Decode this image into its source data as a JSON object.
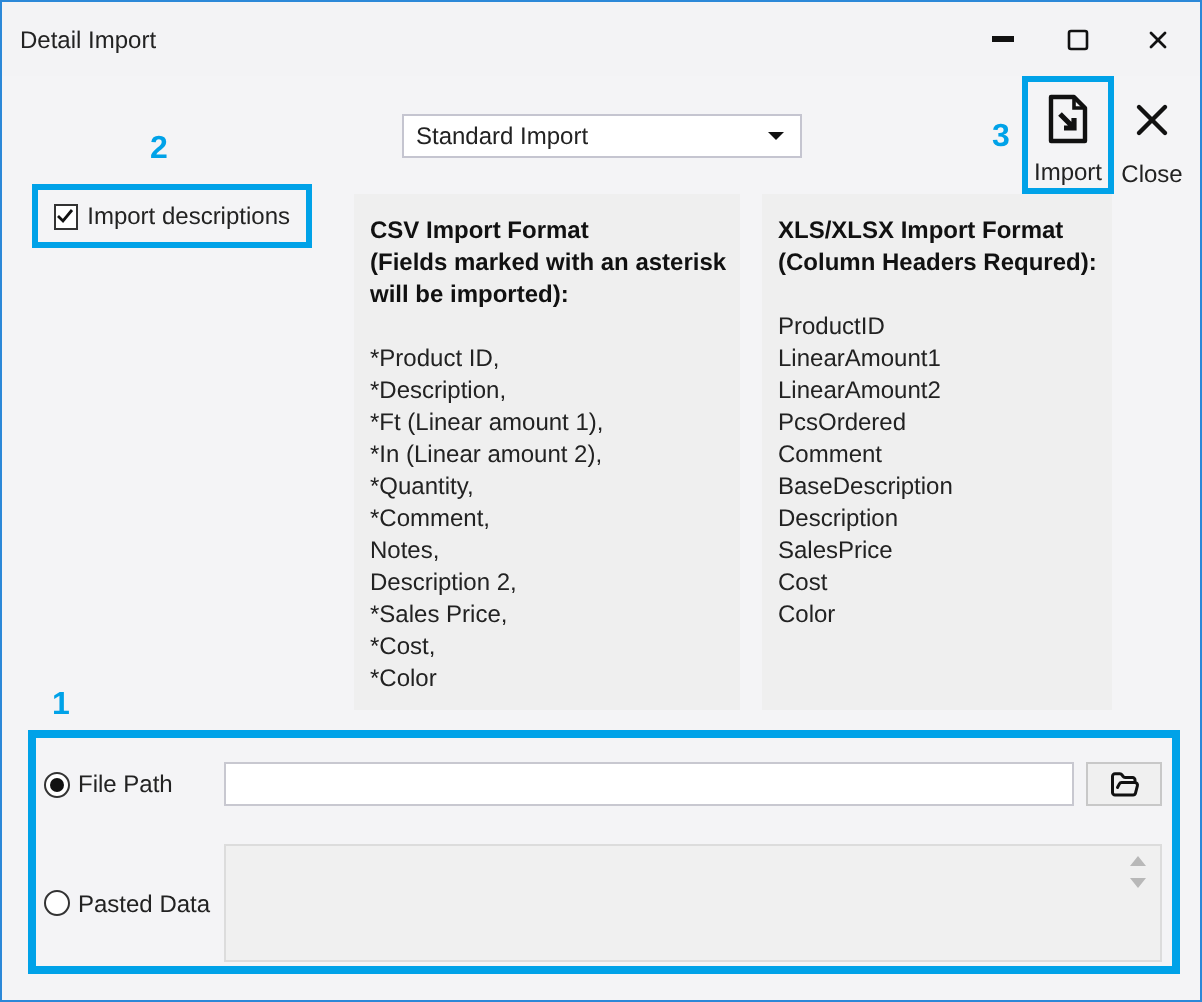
{
  "window": {
    "title": "Detail Import"
  },
  "import_type": {
    "value": "Standard Import"
  },
  "import_descriptions": {
    "label": "Import descriptions",
    "checked": true,
    "callout": "2"
  },
  "toolbar": [
    {
      "kind": "import",
      "label": "Import",
      "callout": "3"
    },
    {
      "kind": "close",
      "label": "Close"
    }
  ],
  "csv_format": {
    "heading": "CSV Import Format\n(Fields marked with an asterisk\nwill be imported):",
    "fields": [
      "*Product ID,",
      "*Description,",
      "*Ft (Linear amount 1),",
      "*In (Linear amount 2),",
      "*Quantity,",
      "*Comment,",
      "Notes,",
      "Description 2,",
      "*Sales Price,",
      "*Cost,",
      "*Color"
    ]
  },
  "xls_format": {
    "heading": "XLS/XLSX Import Format\n(Column Headers Requred):",
    "fields": [
      "ProductID",
      "LinearAmount1",
      "LinearAmount2",
      "PcsOrdered",
      "Comment",
      "BaseDescription",
      "Description",
      "SalesPrice",
      "Cost",
      "Color"
    ]
  },
  "source": {
    "callout": "1",
    "options": [
      {
        "kind": "file",
        "label": "File Path",
        "selected": true
      },
      {
        "kind": "pasted",
        "label": "Pasted Data",
        "selected": false
      }
    ]
  }
}
